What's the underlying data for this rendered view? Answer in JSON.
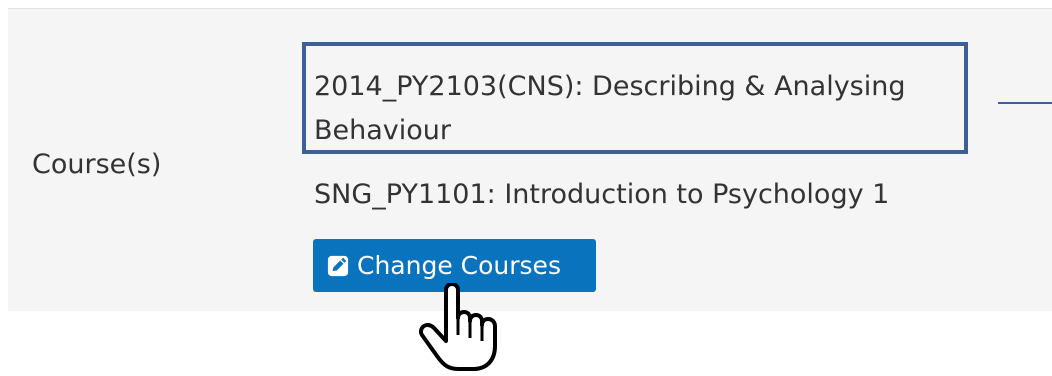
{
  "field": {
    "label": "Course(s)"
  },
  "courses": [
    {
      "text": "2014_PY2103(CNS): Describing & Analysing Behaviour"
    },
    {
      "text": "SNG_PY1101: Introduction to Psychology 1"
    }
  ],
  "actions": {
    "change_courses_label": "Change Courses",
    "change_courses_icon": "edit-icon"
  },
  "overlay": {
    "highlight_color": "#3d5f97",
    "cursor_icon": "hand-pointer-icon"
  },
  "colors": {
    "button": "#0a73bd",
    "panel": "#f5f5f5",
    "text": "#333333"
  }
}
